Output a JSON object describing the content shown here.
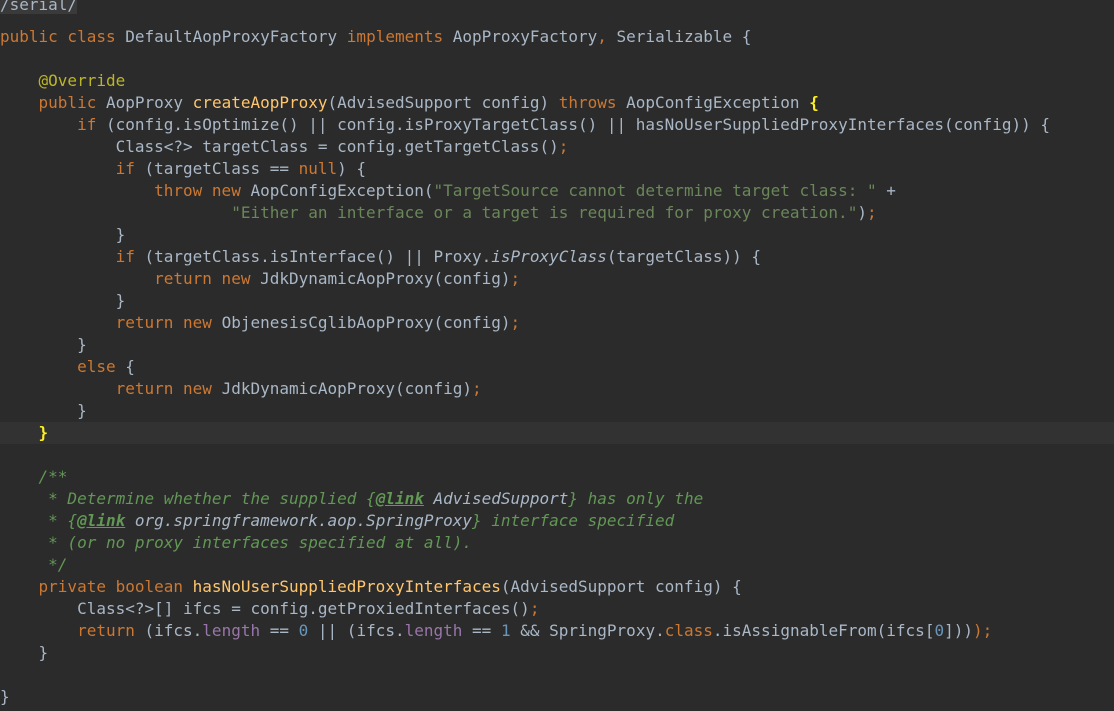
{
  "editor": {
    "lines": [
      {
        "cls": "",
        "tokens": [
          {
            "t": "/serial/",
            "c": "hdr"
          }
        ]
      },
      {
        "cls": "",
        "tokens": [
          {
            "t": "public class ",
            "c": "kw"
          },
          {
            "t": "DefaultAopProxyFactory ",
            "c": "plain"
          },
          {
            "t": "implements ",
            "c": "kw"
          },
          {
            "t": "AopProxyFactory",
            "c": "plain"
          },
          {
            "t": ", ",
            "c": "kw"
          },
          {
            "t": "Serializable {",
            "c": "plain"
          }
        ]
      },
      {
        "cls": "",
        "tokens": []
      },
      {
        "cls": "",
        "tokens": [
          {
            "t": "    ",
            "c": "plain"
          },
          {
            "t": "@Override",
            "c": "ann"
          }
        ]
      },
      {
        "cls": "",
        "tokens": [
          {
            "t": "    ",
            "c": "plain"
          },
          {
            "t": "public ",
            "c": "kw"
          },
          {
            "t": "AopProxy ",
            "c": "plain"
          },
          {
            "t": "createAopProxy",
            "c": "fn"
          },
          {
            "t": "(AdvisedSupport config) ",
            "c": "plain"
          },
          {
            "t": "throws ",
            "c": "kw"
          },
          {
            "t": "AopConfigException ",
            "c": "plain"
          },
          {
            "t": "{",
            "c": "brace-match"
          }
        ]
      },
      {
        "cls": "",
        "tokens": [
          {
            "t": "        ",
            "c": "plain"
          },
          {
            "t": "if ",
            "c": "kw"
          },
          {
            "t": "(config.isOptimize() || config.isProxyTargetClass() || hasNoUserSuppliedProxyInterfaces(config)) {",
            "c": "plain"
          }
        ]
      },
      {
        "cls": "",
        "tokens": [
          {
            "t": "            Class<?> targetClass = config.getTargetClass()",
            "c": "plain"
          },
          {
            "t": ";",
            "c": "kw"
          }
        ]
      },
      {
        "cls": "",
        "tokens": [
          {
            "t": "            ",
            "c": "plain"
          },
          {
            "t": "if ",
            "c": "kw"
          },
          {
            "t": "(targetClass == ",
            "c": "plain"
          },
          {
            "t": "null",
            "c": "kw"
          },
          {
            "t": ") {",
            "c": "plain"
          }
        ]
      },
      {
        "cls": "",
        "tokens": [
          {
            "t": "                ",
            "c": "plain"
          },
          {
            "t": "throw new ",
            "c": "kw"
          },
          {
            "t": "AopConfigException(",
            "c": "plain"
          },
          {
            "t": "\"TargetSource cannot determine target class: \" ",
            "c": "str"
          },
          {
            "t": "+",
            "c": "plain"
          }
        ]
      },
      {
        "cls": "",
        "tokens": [
          {
            "t": "                        ",
            "c": "plain"
          },
          {
            "t": "\"Either an interface or a target is required for proxy creation.\"",
            "c": "str"
          },
          {
            "t": ")",
            "c": "plain"
          },
          {
            "t": ";",
            "c": "kw"
          }
        ]
      },
      {
        "cls": "",
        "tokens": [
          {
            "t": "            }",
            "c": "plain"
          }
        ]
      },
      {
        "cls": "",
        "tokens": [
          {
            "t": "            ",
            "c": "plain"
          },
          {
            "t": "if ",
            "c": "kw"
          },
          {
            "t": "(targetClass.isInterface() || Proxy.",
            "c": "plain"
          },
          {
            "t": "isProxyClass",
            "c": "ital"
          },
          {
            "t": "(targetClass)) {",
            "c": "plain"
          }
        ]
      },
      {
        "cls": "",
        "tokens": [
          {
            "t": "                ",
            "c": "plain"
          },
          {
            "t": "return new ",
            "c": "kw"
          },
          {
            "t": "JdkDynamicAopProxy(config)",
            "c": "plain"
          },
          {
            "t": ";",
            "c": "kw"
          }
        ]
      },
      {
        "cls": "",
        "tokens": [
          {
            "t": "            }",
            "c": "plain"
          }
        ]
      },
      {
        "cls": "",
        "tokens": [
          {
            "t": "            ",
            "c": "plain"
          },
          {
            "t": "return new ",
            "c": "kw"
          },
          {
            "t": "ObjenesisCglibAopProxy(config)",
            "c": "plain"
          },
          {
            "t": ";",
            "c": "kw"
          }
        ]
      },
      {
        "cls": "",
        "tokens": [
          {
            "t": "        }",
            "c": "plain"
          }
        ]
      },
      {
        "cls": "",
        "tokens": [
          {
            "t": "        ",
            "c": "plain"
          },
          {
            "t": "else ",
            "c": "kw"
          },
          {
            "t": "{",
            "c": "plain"
          }
        ]
      },
      {
        "cls": "",
        "tokens": [
          {
            "t": "            ",
            "c": "plain"
          },
          {
            "t": "return new ",
            "c": "kw"
          },
          {
            "t": "JdkDynamicAopProxy(config)",
            "c": "plain"
          },
          {
            "t": ";",
            "c": "kw"
          }
        ]
      },
      {
        "cls": "",
        "tokens": [
          {
            "t": "        }",
            "c": "plain"
          }
        ]
      },
      {
        "cls": "current",
        "tokens": [
          {
            "t": "    ",
            "c": "plain"
          },
          {
            "t": "}",
            "c": "brace-match"
          }
        ]
      },
      {
        "cls": "",
        "tokens": []
      },
      {
        "cls": "",
        "tokens": [
          {
            "t": "    /**",
            "c": "doc"
          }
        ]
      },
      {
        "cls": "",
        "tokens": [
          {
            "t": "     * Determine whether the supplied {",
            "c": "doc"
          },
          {
            "t": "@link",
            "c": "tag"
          },
          {
            "t": " AdvisedSupport",
            "c": "ref"
          },
          {
            "t": "} has only the",
            "c": "doc"
          }
        ]
      },
      {
        "cls": "",
        "tokens": [
          {
            "t": "     * {",
            "c": "doc"
          },
          {
            "t": "@link",
            "c": "tag"
          },
          {
            "t": " org.springframework.aop.SpringProxy",
            "c": "ref"
          },
          {
            "t": "} interface specified",
            "c": "doc"
          }
        ]
      },
      {
        "cls": "",
        "tokens": [
          {
            "t": "     * (or no proxy interfaces specified at all).",
            "c": "doc"
          }
        ]
      },
      {
        "cls": "",
        "tokens": [
          {
            "t": "     */",
            "c": "doc"
          }
        ]
      },
      {
        "cls": "",
        "tokens": [
          {
            "t": "    ",
            "c": "plain"
          },
          {
            "t": "private boolean ",
            "c": "kw"
          },
          {
            "t": "hasNoUserSuppliedProxyInterfaces",
            "c": "fn"
          },
          {
            "t": "(AdvisedSupport config) {",
            "c": "plain"
          }
        ]
      },
      {
        "cls": "",
        "tokens": [
          {
            "t": "        Class<?>[] ifcs = config.getProxiedInterfaces()",
            "c": "plain"
          },
          {
            "t": ";",
            "c": "kw"
          }
        ]
      },
      {
        "cls": "",
        "tokens": [
          {
            "t": "        ",
            "c": "plain"
          },
          {
            "t": "return ",
            "c": "kw"
          },
          {
            "t": "(ifcs.",
            "c": "plain"
          },
          {
            "t": "length ",
            "c": "fld"
          },
          {
            "t": "== ",
            "c": "plain"
          },
          {
            "t": "0 ",
            "c": "num"
          },
          {
            "t": "|| (ifcs.",
            "c": "plain"
          },
          {
            "t": "length ",
            "c": "fld"
          },
          {
            "t": "== ",
            "c": "plain"
          },
          {
            "t": "1 ",
            "c": "num"
          },
          {
            "t": "&& SpringProxy.",
            "c": "plain"
          },
          {
            "t": "class",
            "c": "kw"
          },
          {
            "t": ".isAssignableFrom(ifcs[",
            "c": "plain"
          },
          {
            "t": "0",
            "c": "num"
          },
          {
            "t": "]))",
            "c": "plain"
          },
          {
            "t": ");",
            "c": "kw"
          }
        ]
      },
      {
        "cls": "",
        "tokens": [
          {
            "t": "    }",
            "c": "plain"
          }
        ]
      },
      {
        "cls": "",
        "tokens": []
      },
      {
        "cls": "",
        "tokens": [
          {
            "t": "}",
            "c": "plain"
          }
        ]
      }
    ]
  }
}
